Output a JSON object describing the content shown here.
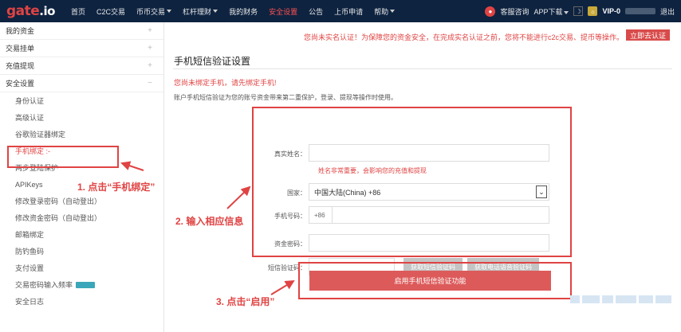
{
  "header": {
    "logo_main": "gate",
    "logo_suffix": ".io",
    "nav": [
      {
        "label": "首页",
        "caret": false,
        "active": false
      },
      {
        "label": "C2C交易",
        "caret": false,
        "active": false
      },
      {
        "label": "币币交易",
        "caret": true,
        "active": false
      },
      {
        "label": "杠杆理财",
        "caret": true,
        "active": false
      },
      {
        "label": "我的财务",
        "caret": false,
        "active": false
      },
      {
        "label": "安全设置",
        "caret": false,
        "active": true
      },
      {
        "label": "公告",
        "caret": false,
        "active": false
      },
      {
        "label": "上币申请",
        "caret": false,
        "active": false
      },
      {
        "label": "帮助",
        "caret": true,
        "active": false
      }
    ],
    "customer_service": "客服咨询",
    "app_download": "APP下载",
    "vip": "VIP-0",
    "logout": "退出"
  },
  "sidebar": {
    "groups": [
      {
        "label": "我的资金",
        "sign": "+"
      },
      {
        "label": "交易挂单",
        "sign": "+"
      },
      {
        "label": "充值提现",
        "sign": "+"
      },
      {
        "label": "安全设置",
        "sign": "−"
      }
    ],
    "items": [
      {
        "label": "身份认证"
      },
      {
        "label": "高级认证"
      },
      {
        "label": "谷歌验证器绑定"
      },
      {
        "label": "手机绑定 :-"
      },
      {
        "label": "两步登陆保护"
      },
      {
        "label": "APIKeys"
      },
      {
        "label": "修改登录密码（自动登出）"
      },
      {
        "label": "修改资金密码（自动登出）"
      },
      {
        "label": "邮箱绑定"
      },
      {
        "label": "防钓鱼码"
      },
      {
        "label": "支付设置"
      },
      {
        "label": "交易密码输入频率"
      },
      {
        "label": "安全日志"
      }
    ]
  },
  "main": {
    "warning": "您尚未实名认证！为保障您的资金安全，在完成实名认证之前，您将不能进行c2c交易、提币等操作。",
    "auth_button": "立即去认证",
    "title": "手机短信验证设置",
    "alert": "您尚未绑定手机，请先绑定手机!",
    "description": "账户手机短信验证为您的账号资金带来第二重保护，登录、提现等操作时使用。",
    "form": {
      "name_label": "真实姓名：",
      "name_hint": "姓名非常重要，会影响您的充值和提现",
      "country_label": "国家：",
      "country_value": "中国大陆(China) +86",
      "phone_label": "手机号码：",
      "phone_prefix": "+86",
      "password_label": "资金密码：",
      "sms_label": "短信验证码：",
      "sms_button": "获取短信验证码",
      "voice_button": "获取电话语音验证码"
    },
    "submit": "启用手机短信验证功能"
  },
  "annotations": {
    "step1": "1. 点击“手机绑定”",
    "step2": "2. 输入相应信息",
    "step3": "3. 点击“启用”"
  },
  "colors": {
    "header_bg": "#0e2340",
    "accent_red": "#e04343",
    "submit_bg": "#dd5a5a"
  }
}
